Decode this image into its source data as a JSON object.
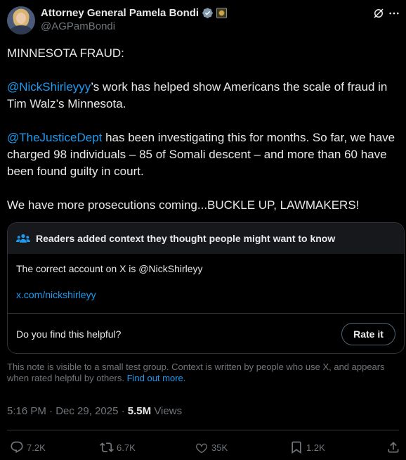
{
  "author": {
    "display_name": "Attorney General Pamela Bondi",
    "handle": "@AGPamBondi"
  },
  "tweet": {
    "line1": "MINNESOTA FRAUD:",
    "p2_mention": "@NickShirleyyy",
    "p2_text": "’s work has helped show Americans the scale of fraud in Tim Walz’s Minnesota.",
    "p3_mention": "@TheJusticeDept",
    "p3_text": " has been investigating this for months. So far, we have charged 98 individuals – 85 of Somali descent – and more than 60 have been found guilty in court.",
    "p4": "We have more prosecutions coming...BUCKLE UP, LAWMAKERS!"
  },
  "community_note": {
    "header": "Readers added context they thought people might want to know",
    "body": "The correct account on X is @NickShirleyy",
    "link": "x.com/nickshirleyy",
    "helpful_question": "Do you find this helpful?",
    "rate_label": "Rate it",
    "disclaimer": "This note is visible to a small test group. Context is written by people who use X, and appears when rated helpful by others.",
    "find_out_more": "Find out more."
  },
  "meta": {
    "time": "5:16 PM",
    "separator": " · ",
    "date": "Dec 29, 2025",
    "views_count": "5.5M",
    "views_label": " Views"
  },
  "actions": {
    "replies": "7.2K",
    "reposts": "6.7K",
    "likes": "35K",
    "bookmarks": "1.2K"
  },
  "colors": {
    "background": "#000000",
    "text": "#e7e9ea",
    "muted": "#71767b",
    "accent": "#1d9bf0",
    "border": "#2f3336"
  }
}
